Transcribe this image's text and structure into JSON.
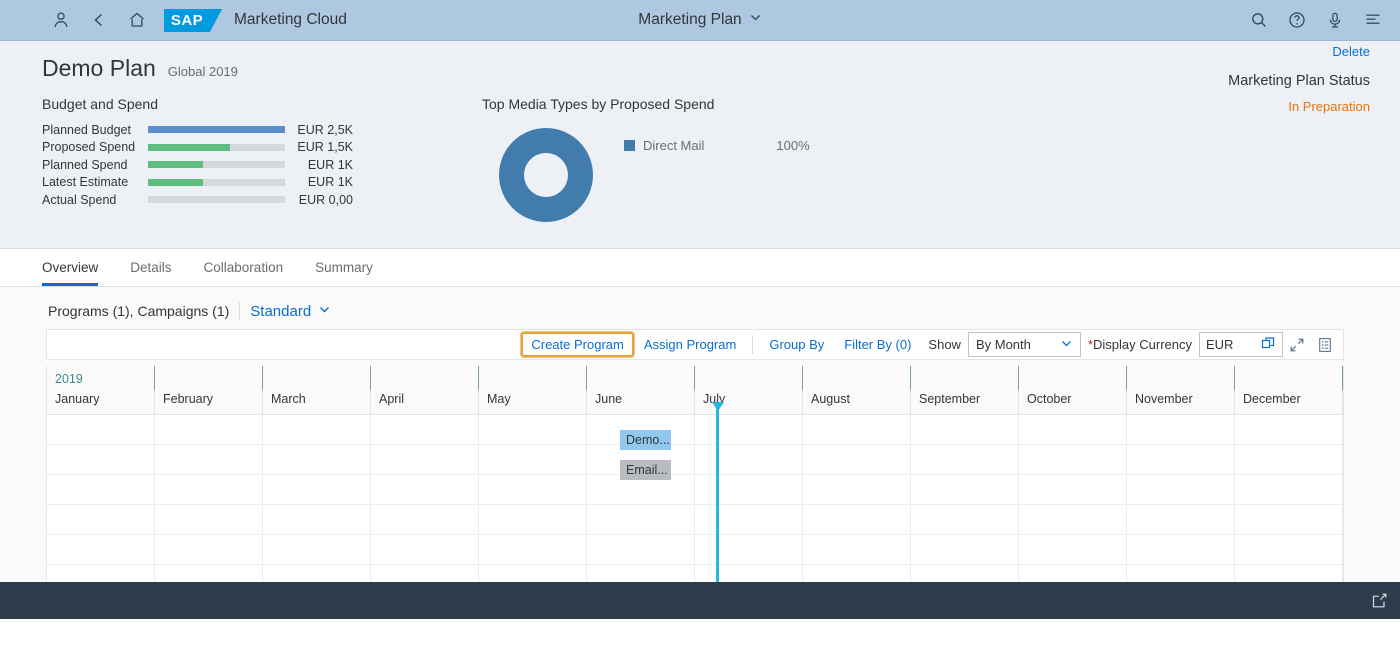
{
  "shell": {
    "app_name": "Marketing Cloud",
    "logo_text": "SAP",
    "title": "Marketing Plan",
    "icons": {
      "user": "user-icon",
      "back": "back-chevron-icon",
      "home": "home-icon",
      "search": "search-icon",
      "help": "help-icon",
      "mic": "microphone-icon",
      "menu": "menu-icon",
      "title_chevron": "chevron-down-icon"
    }
  },
  "page": {
    "title": "Demo Plan",
    "subtitle": "Global 2019"
  },
  "budget": {
    "section_title": "Budget and Spend",
    "rows": [
      {
        "label": "Planned Budget",
        "value": "EUR 2,5K",
        "pct": 100,
        "color": "#5a8fcc"
      },
      {
        "label": "Proposed Spend",
        "value": "EUR 1,5K",
        "pct": 60,
        "color": "#5fbd7f"
      },
      {
        "label": "Planned Spend",
        "value": "EUR 1K",
        "pct": 40,
        "color": "#5fbd7f"
      },
      {
        "label": "Latest Estimate",
        "value": "EUR 1K",
        "pct": 40,
        "color": "#5fbd7f"
      },
      {
        "label": "Actual Spend",
        "value": "EUR 0,00",
        "pct": 0,
        "color": "#5fbd7f"
      }
    ]
  },
  "chart_data": {
    "type": "pie",
    "title": "Top Media Types by Proposed Spend",
    "categories": [
      "Direct Mail"
    ],
    "values": [
      100
    ],
    "labels": [
      "100%"
    ],
    "colors": [
      "#427cac"
    ],
    "legend_position": "right",
    "donut": true
  },
  "status": {
    "delete_label": "Delete",
    "label": "Marketing Plan Status",
    "value": "In Preparation",
    "value_color": "#e9730c"
  },
  "tabs": [
    {
      "label": "Overview",
      "active": true
    },
    {
      "label": "Details",
      "active": false
    },
    {
      "label": "Collaboration",
      "active": false
    },
    {
      "label": "Summary",
      "active": false
    }
  ],
  "table": {
    "count_text": "Programs (1), Campaigns (1)",
    "variant": "Standard"
  },
  "toolbar": {
    "create_program": "Create Program",
    "assign_program": "Assign Program",
    "group_by": "Group By",
    "filter_by": "Filter By (0)",
    "show_label": "Show",
    "show_value": "By Month",
    "currency_label": "Display Currency",
    "currency_required_mark": "*",
    "currency_value": "EUR",
    "icons": {
      "value_help": "value-help-icon",
      "fullscreen": "fullscreen-icon",
      "settings": "table-settings-icon"
    },
    "focus_color": "#e8a33d"
  },
  "gantt": {
    "year": "2019",
    "months": [
      "January",
      "February",
      "March",
      "April",
      "May",
      "June",
      "July",
      "August",
      "September",
      "October",
      "November",
      "December"
    ],
    "bars": [
      {
        "label": "Demo...",
        "color": "#91c8ef",
        "month": "June"
      },
      {
        "label": "Email...",
        "color": "#b9bdc1",
        "month": "June"
      }
    ],
    "today_marker_color": "#25b7e0"
  },
  "footer": {
    "share_icon": "share-export-icon"
  }
}
